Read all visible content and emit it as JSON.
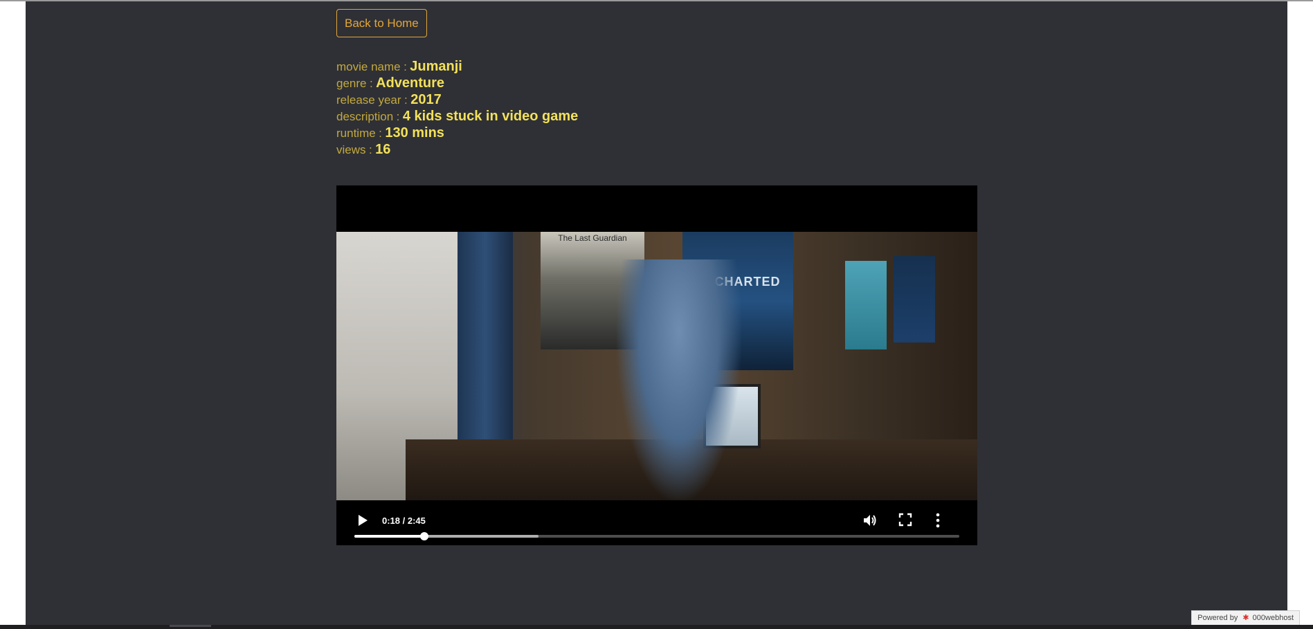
{
  "back_button": {
    "label": "Back to Home"
  },
  "movie": {
    "fields": [
      {
        "label": "movie name",
        "value": "Jumanji"
      },
      {
        "label": "genre",
        "value": "Adventure"
      },
      {
        "label": "release year",
        "value": "2017"
      },
      {
        "label": "description",
        "value": "4 kids stuck in video game"
      },
      {
        "label": "runtime",
        "value": "130 mins"
      },
      {
        "label": "views",
        "value": "16"
      }
    ],
    "separator": ":"
  },
  "video": {
    "current_time": "0:18",
    "duration": "2:45",
    "time_display": "0:18 / 2:45",
    "played_fraction": 0.115,
    "buffered_fraction": 0.304,
    "icons": {
      "play": "play-icon",
      "volume": "volume-icon",
      "fullscreen": "fullscreen-icon",
      "more": "more-vertical-icon"
    },
    "frame_texts": {
      "poster1": "The Last Guardian",
      "poster2": "UNCHARTED"
    }
  },
  "footer": {
    "powered_prefix": "Powered by",
    "host_name": "000webhost"
  }
}
